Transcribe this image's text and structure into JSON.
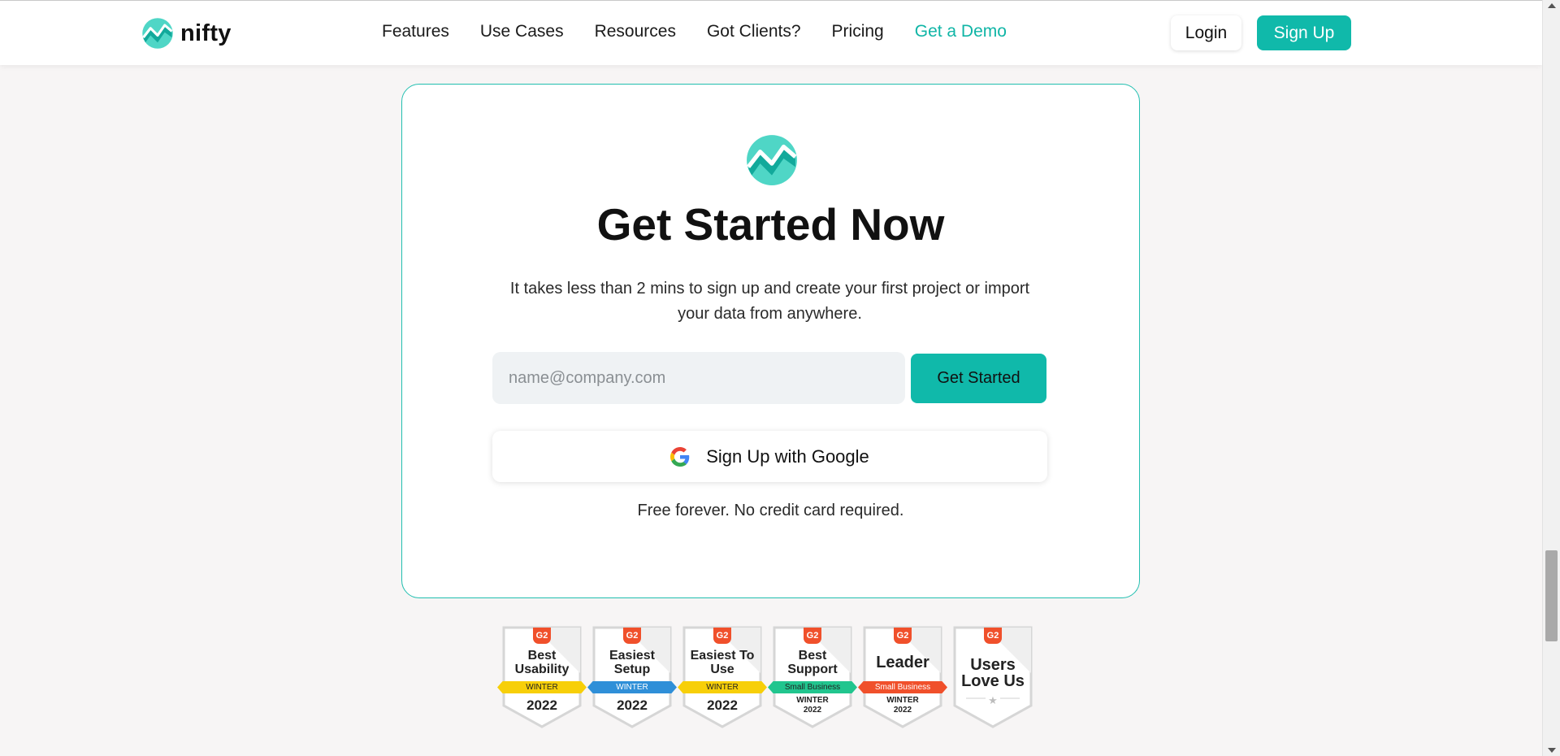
{
  "brand": {
    "name": "nifty",
    "accent_color": "#10b9aa"
  },
  "nav": {
    "items": [
      {
        "label": "Features",
        "accent": false
      },
      {
        "label": "Use Cases",
        "accent": false
      },
      {
        "label": "Resources",
        "accent": false
      },
      {
        "label": "Got Clients?",
        "accent": false
      },
      {
        "label": "Pricing",
        "accent": false
      },
      {
        "label": "Get a Demo",
        "accent": true
      }
    ],
    "login_label": "Login",
    "signup_label": "Sign Up"
  },
  "hero": {
    "icon": "nifty-logo-icon",
    "title": "Get Started Now",
    "subtitle": "It takes less than 2 mins to sign up and create your first project or import your data from anywhere.",
    "email_placeholder": "name@company.com",
    "email_value": "",
    "cta_label": "Get Started",
    "google_label": "Sign Up with Google",
    "google_icon": "google-g-icon",
    "note": "Free forever. No credit card required."
  },
  "badges": [
    {
      "title": "Best Usability",
      "ribbon": "WINTER",
      "ribbon_color": "#f7cf09",
      "season": "",
      "year": "2022"
    },
    {
      "title": "Easiest Setup",
      "ribbon": "WINTER",
      "ribbon_color": "#2f8fd8",
      "season": "",
      "year": "2022"
    },
    {
      "title": "Easiest To Use",
      "ribbon": "WINTER",
      "ribbon_color": "#f7cf09",
      "season": "",
      "year": "2022"
    },
    {
      "title": "Best Support",
      "ribbon": "Small Business",
      "ribbon_color": "#21c58e",
      "season": "WINTER",
      "year": "2022"
    },
    {
      "title": "Leader",
      "ribbon": "Small Business",
      "ribbon_color": "#f0502b",
      "season": "WINTER",
      "year": "2022"
    },
    {
      "title": "Users Love Us",
      "ribbon": "",
      "ribbon_color": "",
      "season": "",
      "year": ""
    }
  ],
  "badge_brand": "G2"
}
